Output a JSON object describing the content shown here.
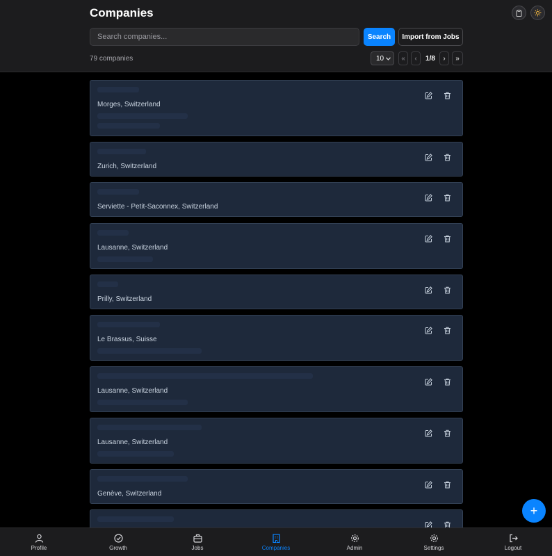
{
  "header": {
    "title": "Companies",
    "search_placeholder": "Search companies...",
    "search_label": "Search",
    "import_label": "Import from Jobs",
    "count_text": "79 companies",
    "page_size": "10",
    "page_info": "1/8",
    "first_label": "«",
    "prev_label": "‹",
    "next_label": "›",
    "last_label": "»",
    "icons": [
      "clipboard-icon",
      "sun-icon"
    ]
  },
  "companies": [
    {
      "location": "Morges, Switzerland"
    },
    {
      "location": "Zurich, Switzerland"
    },
    {
      "location": "Serviette - Petit-Saconnex, Switzerland"
    },
    {
      "location": "Lausanne, Switzerland"
    },
    {
      "location": "Prilly, Switzerland"
    },
    {
      "location": "Le Brassus, Suisse"
    },
    {
      "location": "Lausanne, Switzerland"
    },
    {
      "location": "Lausanne, Switzerland"
    },
    {
      "location": "Genève, Switzerland"
    },
    {
      "location": ""
    }
  ],
  "nav": {
    "items": [
      {
        "label": "Profile",
        "icon": "user-icon"
      },
      {
        "label": "Growth",
        "icon": "check-circle-icon"
      },
      {
        "label": "Jobs",
        "icon": "briefcase-icon"
      },
      {
        "label": "Companies",
        "icon": "building-icon",
        "active": true
      },
      {
        "label": "Admin",
        "icon": "gear-icon"
      },
      {
        "label": "Settings",
        "icon": "gear-icon"
      },
      {
        "label": "Logout",
        "icon": "logout-icon"
      }
    ]
  },
  "fab_label": "+",
  "colors": {
    "accent": "#0a84ff",
    "card_bg": "#1e293b",
    "header_bg": "#1c1c1e"
  }
}
